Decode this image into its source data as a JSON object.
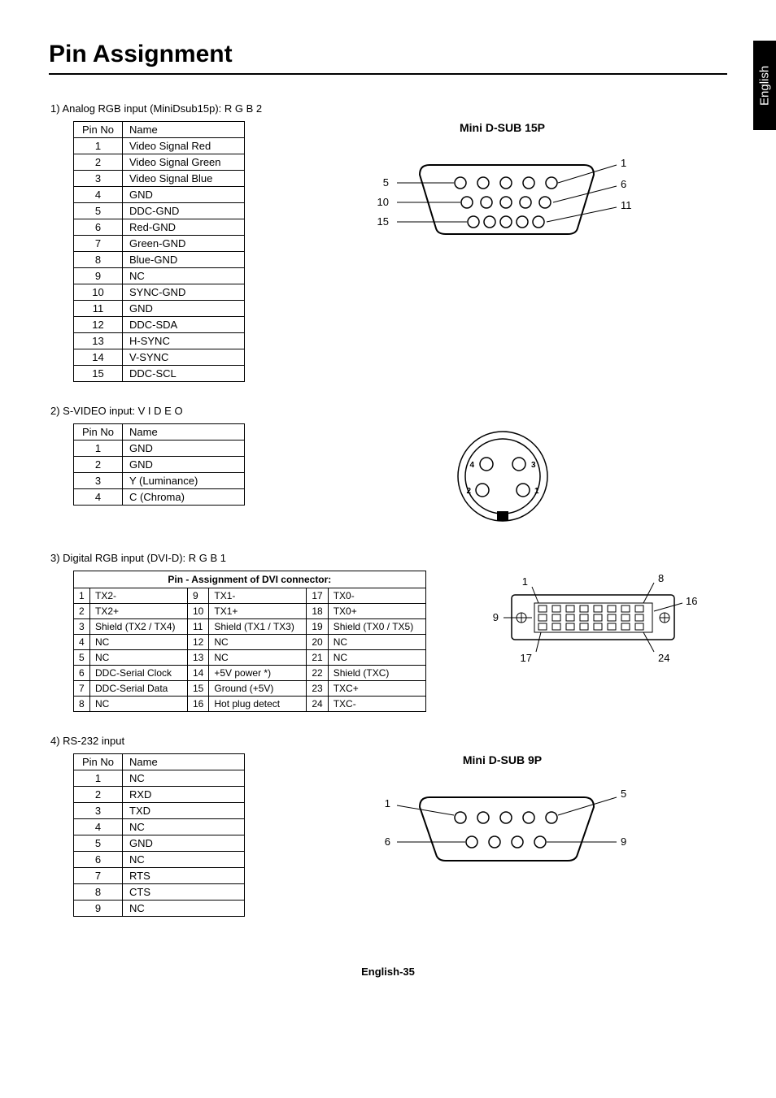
{
  "side_tab": "English",
  "title": "Pin Assignment",
  "sections": {
    "s1": {
      "label": "1)  Analog RGB input (MiniDsub15p): R G B 2",
      "header_pin": "Pin No",
      "header_name": "Name",
      "rows": [
        {
          "pin": "1",
          "name": "Video Signal Red"
        },
        {
          "pin": "2",
          "name": "Video Signal Green"
        },
        {
          "pin": "3",
          "name": "Video Signal Blue"
        },
        {
          "pin": "4",
          "name": "GND"
        },
        {
          "pin": "5",
          "name": "DDC-GND"
        },
        {
          "pin": "6",
          "name": "Red-GND"
        },
        {
          "pin": "7",
          "name": "Green-GND"
        },
        {
          "pin": "8",
          "name": "Blue-GND"
        },
        {
          "pin": "9",
          "name": "NC"
        },
        {
          "pin": "10",
          "name": "SYNC-GND"
        },
        {
          "pin": "11",
          "name": "GND"
        },
        {
          "pin": "12",
          "name": "DDC-SDA"
        },
        {
          "pin": "13",
          "name": "H-SYNC"
        },
        {
          "pin": "14",
          "name": "V-SYNC"
        },
        {
          "pin": "15",
          "name": "DDC-SCL"
        }
      ],
      "diagram_title": "Mini D-SUB 15P",
      "labels": {
        "l1": "1",
        "l5": "5",
        "l6": "6",
        "l10": "10",
        "l11": "11",
        "l15": "15"
      }
    },
    "s2": {
      "label": "2)  S-VIDEO input: V I D E O",
      "header_pin": "Pin No",
      "header_name": "Name",
      "rows": [
        {
          "pin": "1",
          "name": "GND"
        },
        {
          "pin": "2",
          "name": "GND"
        },
        {
          "pin": "3",
          "name": "Y (Luminance)"
        },
        {
          "pin": "4",
          "name": "C (Chroma)"
        }
      ],
      "labels": {
        "p1": "1",
        "p2": "2",
        "p3": "3",
        "p4": "4"
      }
    },
    "s3": {
      "label": "3)  Digital RGB input (DVI-D): R G B 1",
      "caption": "Pin - Assignment of DVI connector:",
      "rows": [
        {
          "c1": "1",
          "n1": "TX2-",
          "c2": "9",
          "n2": "TX1-",
          "c3": "17",
          "n3": "TX0-"
        },
        {
          "c1": "2",
          "n1": "TX2+",
          "c2": "10",
          "n2": "TX1+",
          "c3": "18",
          "n3": "TX0+"
        },
        {
          "c1": "3",
          "n1": "Shield (TX2 / TX4)",
          "c2": "11",
          "n2": "Shield (TX1 / TX3)",
          "c3": "19",
          "n3": "Shield (TX0 / TX5)"
        },
        {
          "c1": "4",
          "n1": "NC",
          "c2": "12",
          "n2": "NC",
          "c3": "20",
          "n3": "NC"
        },
        {
          "c1": "5",
          "n1": "NC",
          "c2": "13",
          "n2": "NC",
          "c3": "21",
          "n3": "NC"
        },
        {
          "c1": "6",
          "n1": "DDC-Serial Clock",
          "c2": "14",
          "n2": "+5V power *)",
          "c3": "22",
          "n3": "Shield (TXC)"
        },
        {
          "c1": "7",
          "n1": "DDC-Serial Data",
          "c2": "15",
          "n2": "Ground (+5V)",
          "c3": "23",
          "n3": "TXC+"
        },
        {
          "c1": "8",
          "n1": "NC",
          "c2": "16",
          "n2": "Hot plug detect",
          "c3": "24",
          "n3": "TXC-"
        }
      ],
      "labels": {
        "l1": "1",
        "l8": "8",
        "l9": "9",
        "l16": "16",
        "l17": "17",
        "l24": "24"
      }
    },
    "s4": {
      "label": "4)  RS-232 input",
      "header_pin": "Pin No",
      "header_name": "Name",
      "rows": [
        {
          "pin": "1",
          "name": "NC"
        },
        {
          "pin": "2",
          "name": "RXD"
        },
        {
          "pin": "3",
          "name": "TXD"
        },
        {
          "pin": "4",
          "name": "NC"
        },
        {
          "pin": "5",
          "name": "GND"
        },
        {
          "pin": "6",
          "name": "NC"
        },
        {
          "pin": "7",
          "name": "RTS"
        },
        {
          "pin": "8",
          "name": "CTS"
        },
        {
          "pin": "9",
          "name": "NC"
        }
      ],
      "diagram_title": "Mini D-SUB 9P",
      "labels": {
        "l1": "1",
        "l5": "5",
        "l6": "6",
        "l9": "9"
      }
    }
  },
  "footer": "English-35"
}
